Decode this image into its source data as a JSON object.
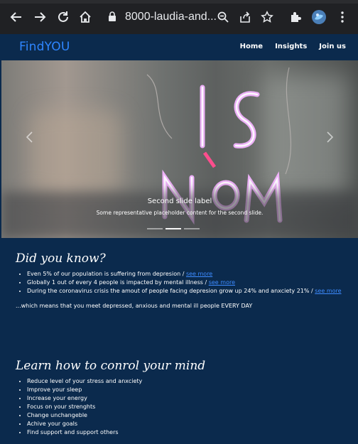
{
  "browser": {
    "url": "8000-laudia-and..."
  },
  "navbar": {
    "brand": "FindYOU",
    "links": [
      "Home",
      "Insights",
      "Join us"
    ]
  },
  "carousel": {
    "caption_title": "Second slide label",
    "caption_text": "Some representative placeholder content for the second slide."
  },
  "did_you_know": {
    "heading": "Did you know?",
    "items": [
      {
        "text": "Even 5% of our population is suffering from depresion / ",
        "link": "see more"
      },
      {
        "text": "Globally 1 out of every 4 people is impacted by mental illness / ",
        "link": "see more"
      },
      {
        "text": "During the coronavirus crisis the amout of people facing depresion grow up 24% and anxciety 21% / ",
        "link": "see more"
      }
    ],
    "summary": "...which means that you meet depressed, anxious and mental ill people EVERY DAY"
  },
  "learn": {
    "heading": "Learn how to conrol your mind",
    "items": [
      "Reduce level of your stress and anxciety",
      "Improve your sleep",
      "Increase your energy",
      "Focus on your strenghts",
      "Change unchangeble",
      "Achive your goals",
      "Find support and support others"
    ]
  },
  "colors": {
    "page_background": "#0b2a4d",
    "brand": "#2e86ff",
    "link": "#3d8bff",
    "chrome": "#202124"
  }
}
